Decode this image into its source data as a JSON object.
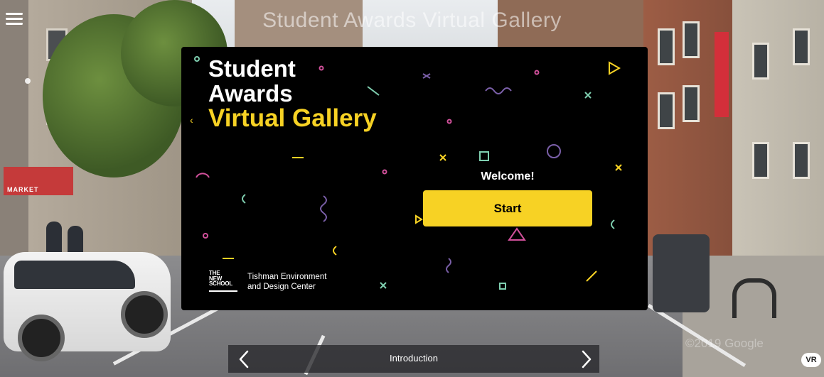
{
  "viewer": {
    "page_heading": "Student Awards Virtual Gallery",
    "watermark": "©2019 Google"
  },
  "card": {
    "title_line1": "Student",
    "title_line2": "Awards",
    "title_line3": "Virtual Gallery",
    "welcome_text": "Welcome!",
    "start_label": "Start",
    "logo_text_line1": "THE",
    "logo_text_line2": "NEW",
    "logo_text_line3": "SCHOOL",
    "org_line1": "Tishman Environment",
    "org_line2": "and Design Center"
  },
  "nav": {
    "current_scene": "Introduction",
    "vr_label": "VR"
  },
  "background": {
    "awning_text": "MARKET"
  },
  "colors": {
    "accent_yellow": "#f7d224",
    "card_background": "#000000",
    "confetti_purple": "#7a5fa8",
    "confetti_teal": "#7fcfb0",
    "confetti_pink": "#d0509a"
  },
  "icons": [
    "menu-icon",
    "chevron-left-icon",
    "chevron-right-icon"
  ]
}
